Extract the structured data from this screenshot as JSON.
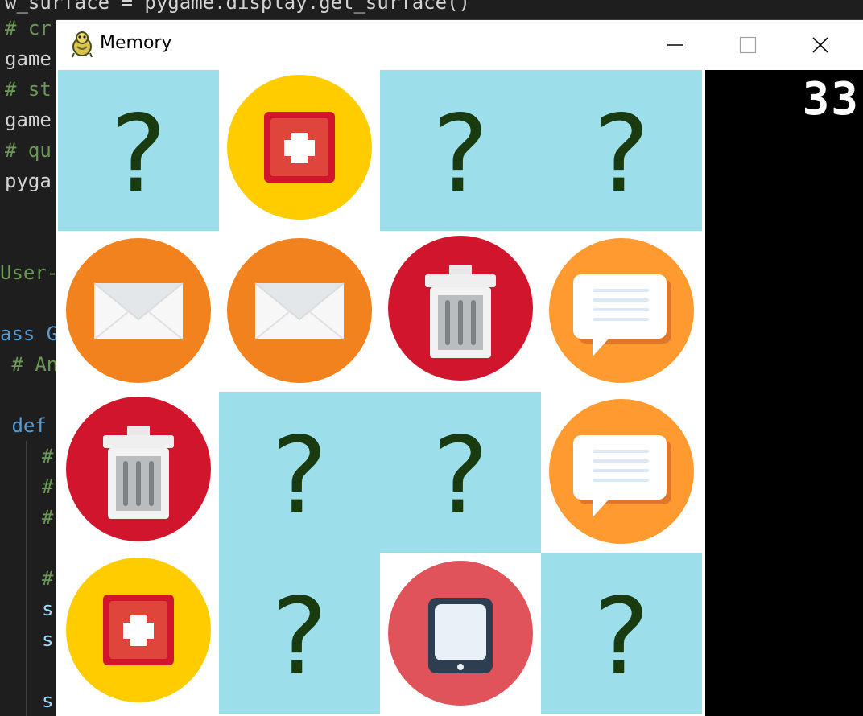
{
  "editor": {
    "lines": [
      {
        "text": "w_surface = pygame.display.get_surface()",
        "kind": "plain"
      },
      {
        "text": "# cr",
        "kind": "comment"
      },
      {
        "text": "game",
        "kind": "plain"
      },
      {
        "text": "# st",
        "kind": "comment"
      },
      {
        "text": "game",
        "kind": "plain"
      },
      {
        "text": "# qu",
        "kind": "comment"
      },
      {
        "text": "pyga",
        "kind": "plain"
      },
      {
        "text": "User-",
        "kind": "comment"
      },
      {
        "text": "ass G",
        "kind": "keyword"
      },
      {
        "text": " # An",
        "kind": "comment"
      },
      {
        "text": " def ",
        "kind": "keyword"
      },
      {
        "text": "#",
        "kind": "comment"
      },
      {
        "text": "#",
        "kind": "comment"
      },
      {
        "text": "#",
        "kind": "comment"
      },
      {
        "text": "#",
        "kind": "comment"
      },
      {
        "text": "s",
        "kind": "dim"
      },
      {
        "text": "s",
        "kind": "dim"
      },
      {
        "text": "s",
        "kind": "dim"
      }
    ]
  },
  "window": {
    "title": "Memory",
    "icon": "pygame-snake-icon",
    "buttons": {
      "minimize_icon": "minimize-icon",
      "maximize_icon": "maximize-icon",
      "close_icon": "close-icon"
    }
  },
  "game": {
    "score": "33",
    "hidden_symbol": "?",
    "grid": [
      [
        "hidden",
        "first-aid",
        "hidden",
        "hidden"
      ],
      [
        "mail",
        "mail",
        "trash",
        "chat"
      ],
      [
        "trash",
        "hidden",
        "hidden",
        "chat"
      ],
      [
        "first-aid",
        "hidden",
        "tablet",
        "hidden"
      ]
    ],
    "colors": {
      "hidden_tile": "#9cdfea",
      "question_mark": "#1a3a10",
      "first_aid_circle": "#ffcc00",
      "mail_circle": "#f2821e",
      "trash_circle": "#d0152c",
      "chat_circle": "#ff9a30",
      "tablet_circle": "#e0535a"
    }
  }
}
